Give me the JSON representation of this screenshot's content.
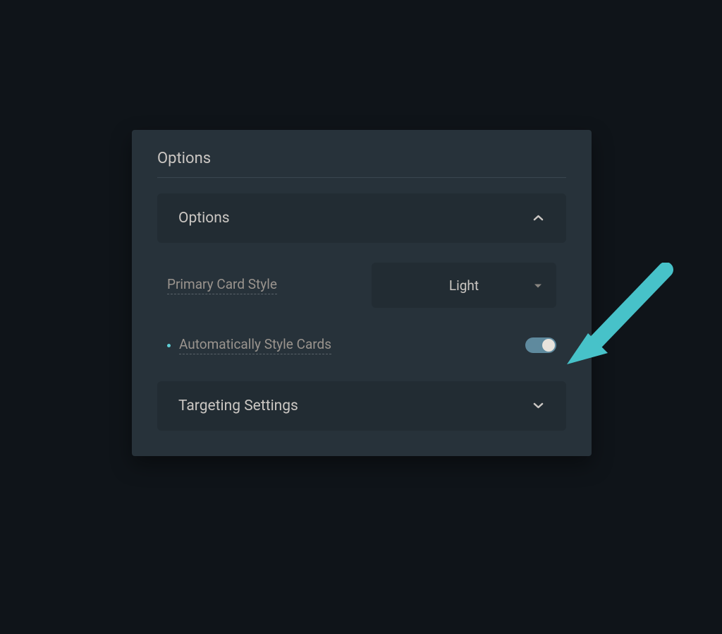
{
  "panel": {
    "title": "Options",
    "sections": [
      {
        "header_label": "Options",
        "expanded": true,
        "fields": {
          "primary_card_style": {
            "label": "Primary Card Style",
            "selected": "Light"
          },
          "auto_style": {
            "label": "Automatically Style Cards",
            "enabled": true
          }
        }
      },
      {
        "header_label": "Targeting Settings",
        "expanded": false
      }
    ]
  },
  "colors": {
    "accent": "#5fcfd6",
    "annotation_arrow": "#47c2c9"
  }
}
